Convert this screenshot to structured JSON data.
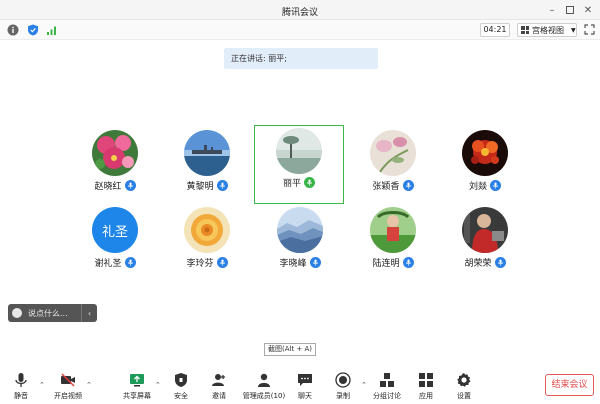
{
  "window": {
    "title": "腾讯会议"
  },
  "infobar": {
    "timer": "04:21",
    "view_mode": "宫格视图"
  },
  "speaking": {
    "label": "正在讲话:",
    "name": "丽平;"
  },
  "participants": [
    {
      "name": "赵晓红",
      "mic": "blue"
    },
    {
      "name": "黄黎明",
      "mic": "blue"
    },
    {
      "name": "丽平",
      "mic": "green"
    },
    {
      "name": "张颖香",
      "mic": "blue"
    },
    {
      "name": "刘燚",
      "mic": "blue"
    },
    {
      "name": "谢礼圣",
      "mic": "blue",
      "avatar_text": "礼圣"
    },
    {
      "name": "李玲芬",
      "mic": "blue"
    },
    {
      "name": "李晓峰",
      "mic": "blue"
    },
    {
      "name": "陆连明",
      "mic": "blue"
    },
    {
      "name": "胡荣荣",
      "mic": "blue"
    }
  ],
  "chat": {
    "placeholder": "说点什么..."
  },
  "screenshot_tip": "截图(Alt + A)",
  "toolbar": {
    "mute": "静音",
    "video": "开启视频",
    "share": "共享屏幕",
    "security": "安全",
    "invite": "邀请",
    "members": "管理成员(10)",
    "chat": "聊天",
    "record": "录制",
    "breakout": "分组讨论",
    "apps": "应用",
    "settings": "设置",
    "end": "结束会议"
  },
  "colors": {
    "accent_blue": "#2a80e4",
    "speaking_green": "#39b54a",
    "end_red": "#e04a4a"
  }
}
